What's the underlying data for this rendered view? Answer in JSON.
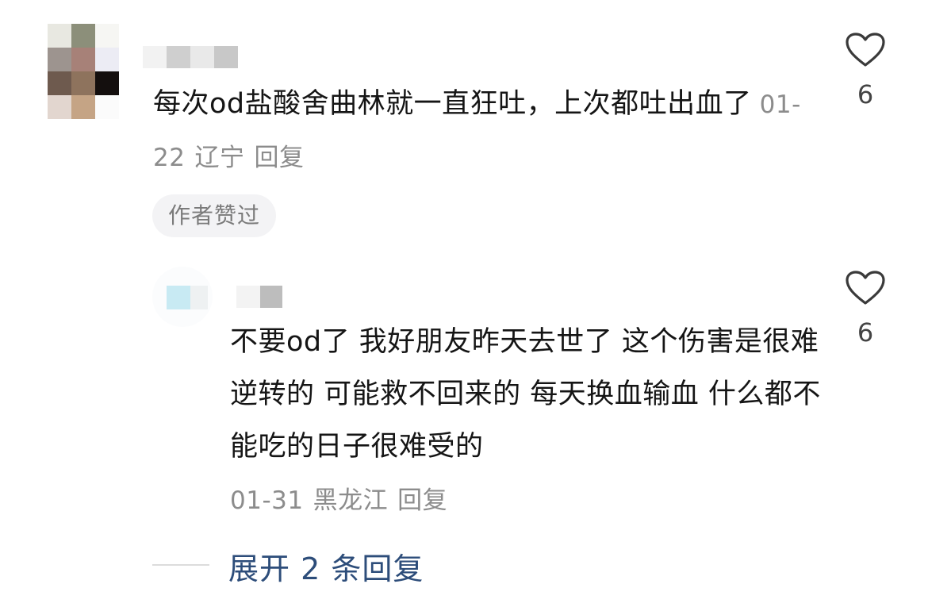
{
  "comments": [
    {
      "text": "每次od盐酸舍曲林就一直狂吐，上次都吐出血了",
      "date": "01-22",
      "location": "辽宁",
      "reply_label": "回复",
      "badge": "作者赞过",
      "likes": "6"
    }
  ],
  "replies": [
    {
      "text": "不要od了 我好朋友昨天去世了 这个伤害是很难逆转的 可能救不回来的 每天换血输血 什么都不能吃的日子很难受的",
      "date": "01-31",
      "location": "黑龙江",
      "reply_label": "回复",
      "likes": "6"
    }
  ],
  "expand_replies_label": "展开 2 条回复",
  "icons": {
    "like": "heart-outline-icon"
  },
  "colors": {
    "text": "#151515",
    "meta": "#8c8c8c",
    "link": "#2d4d7a",
    "badge_bg": "#f3f3f5"
  }
}
